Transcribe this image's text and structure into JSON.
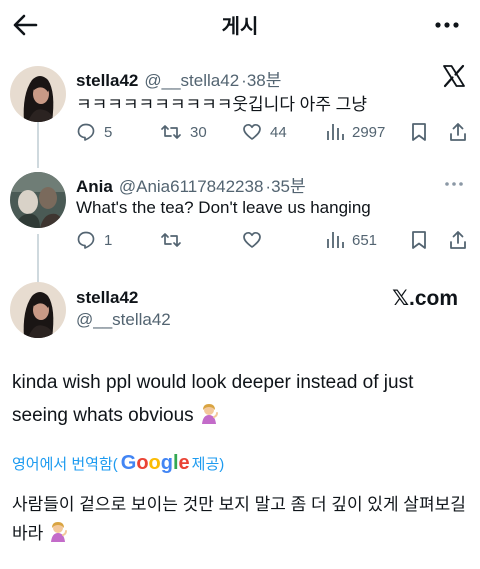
{
  "header": {
    "title": "게시"
  },
  "tweets": [
    {
      "name": "stella42",
      "handle": "@__stella42",
      "time": "·38분",
      "text": "ㅋㅋㅋㅋㅋㅋㅋㅋㅋㅋ웃깁니다 아주 그냥",
      "replies": "5",
      "retweets": "30",
      "likes": "44",
      "views": "2997"
    },
    {
      "name": "Ania",
      "handle": "@Ania6117842238",
      "time": "·35분",
      "text": "What's the tea? Don't leave us hanging",
      "replies": "1",
      "retweets": "",
      "likes": "",
      "views": "651"
    }
  ],
  "quoted": {
    "name": "stella42",
    "handle": "@__stella42",
    "brand": "𝕏.com",
    "text": "kinda wish ppl would look deeper instead of just seeing whats obvious",
    "translate_label": "영어에서 번역함(",
    "google": [
      "G",
      "o",
      "o",
      "g",
      "l",
      "e"
    ],
    "translate_suffix": " 제공)",
    "translated": "사람들이 겉으로 보이는 것만 보지 말고 좀 더 깊이 있게 살펴보길 바라"
  },
  "icons": {
    "back": "arrow-left-icon",
    "more": "more-horizontal-icon",
    "x_logo": "x-logo-icon",
    "reply": "reply-icon",
    "retweet": "retweet-icon",
    "like": "heart-icon",
    "views": "views-bar-icon",
    "bookmark": "bookmark-icon",
    "share": "share-icon",
    "emoji": "woman-tipping-hand-emoji"
  },
  "colors": {
    "text": "#0f1419",
    "secondary": "#536471",
    "link": "#1d9bf0",
    "google_blue": "#4285f4",
    "google_red": "#ea4335",
    "google_yellow": "#fbbc05",
    "google_green": "#34a853"
  }
}
